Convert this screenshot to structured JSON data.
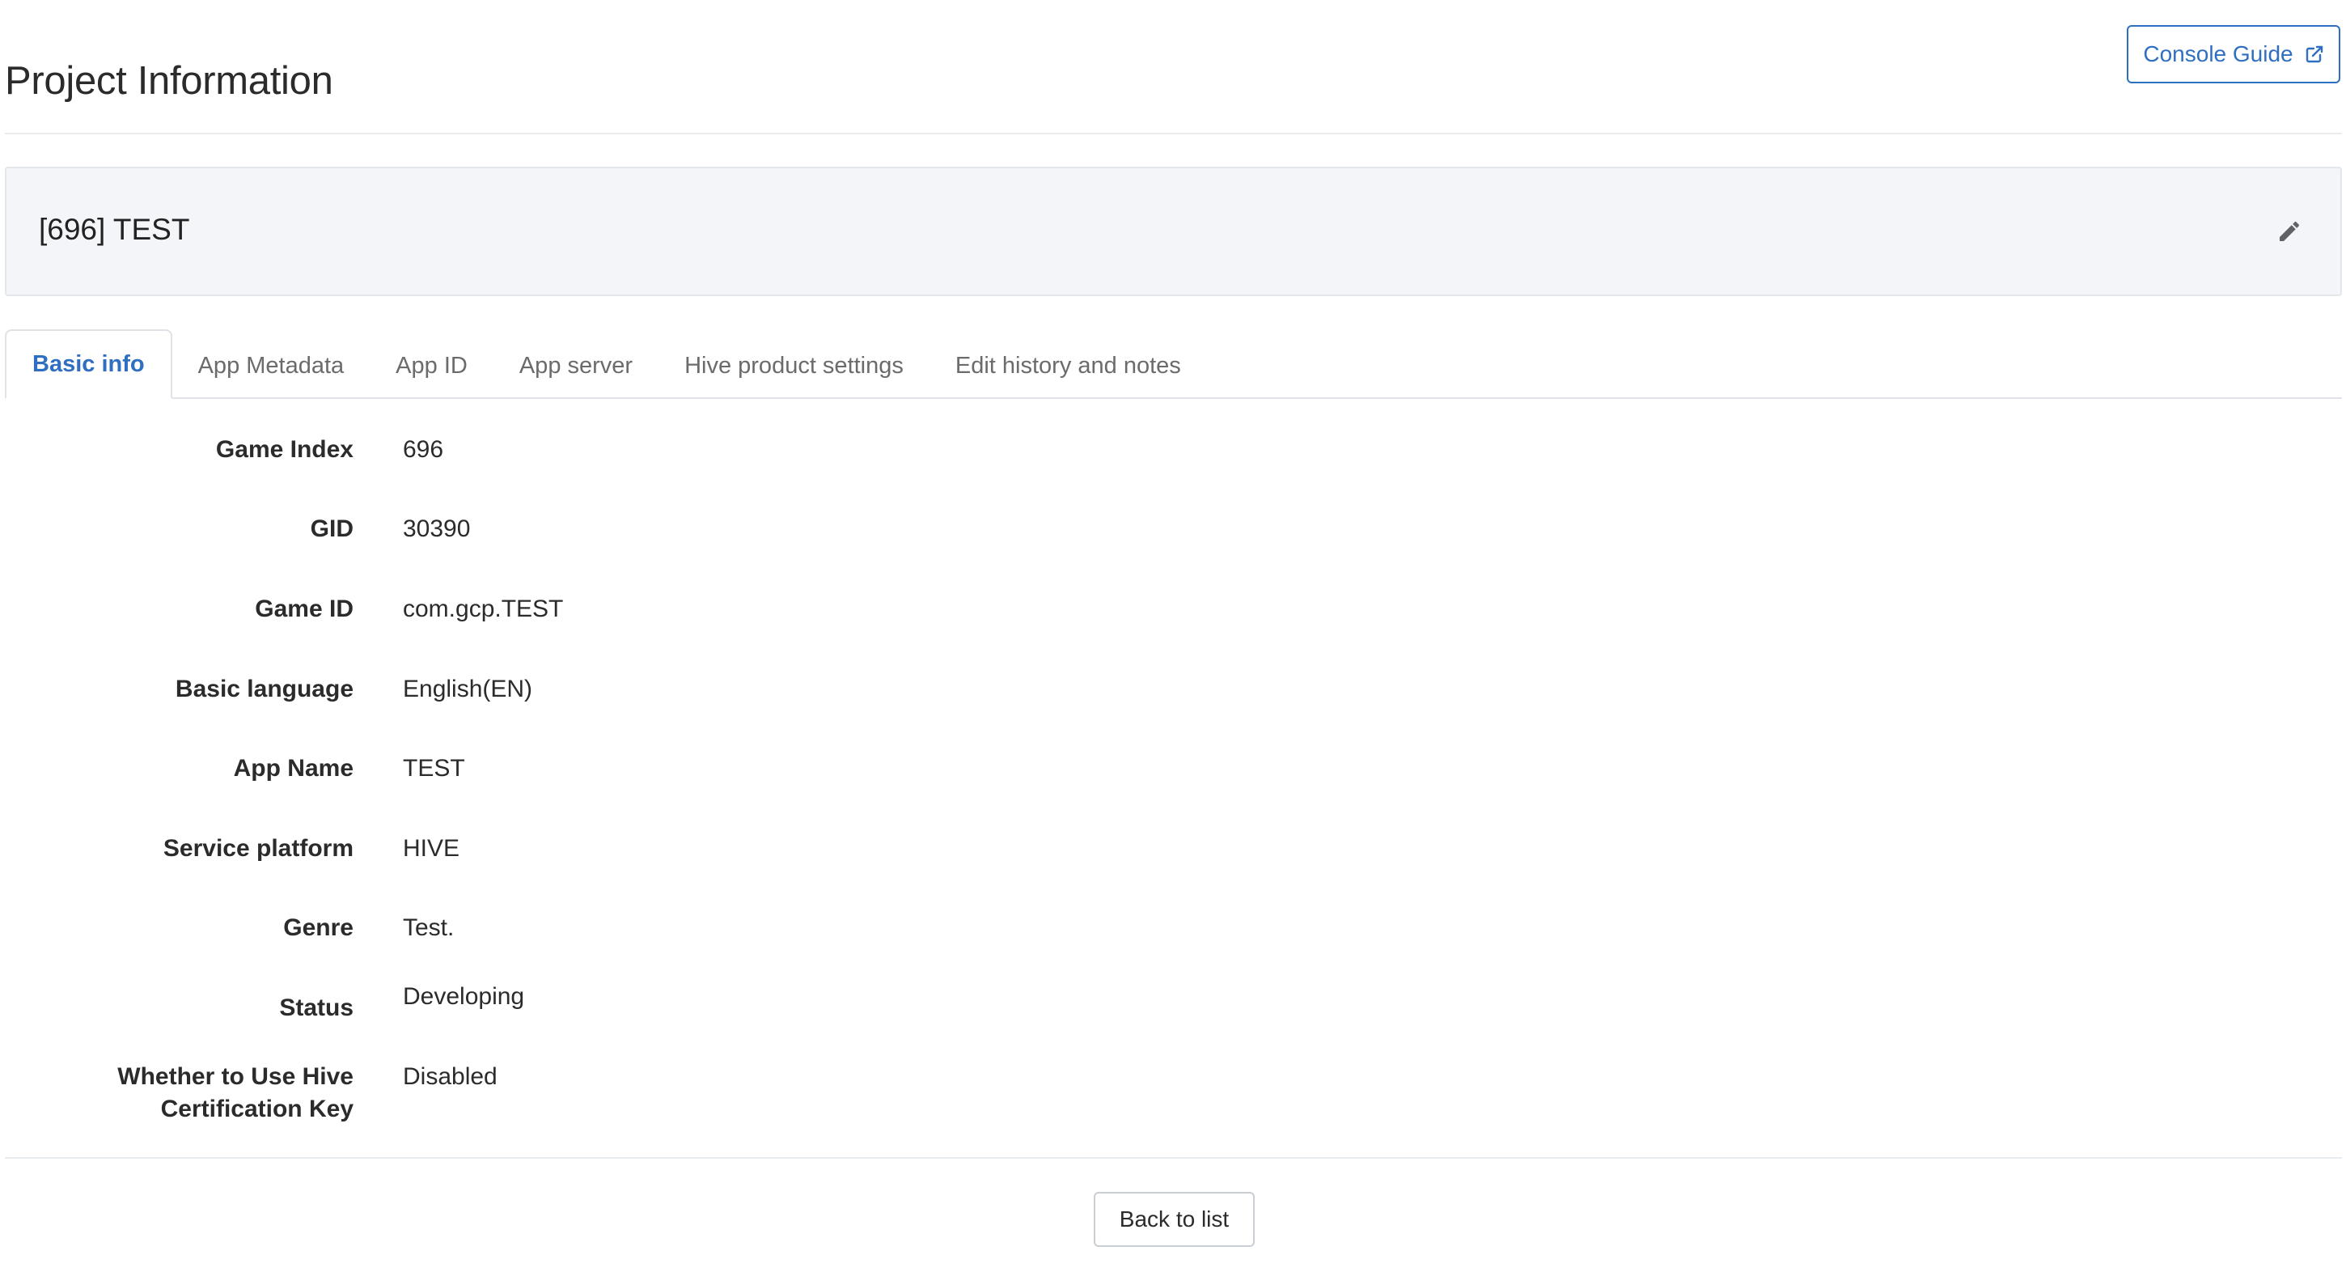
{
  "header": {
    "title": "Project Information",
    "guide_button_label": "Console Guide",
    "guide_icon": "external-link-icon"
  },
  "project": {
    "name": "[696] TEST",
    "edit_icon": "pencil-icon"
  },
  "tabs": [
    {
      "label": "Basic info",
      "active": true
    },
    {
      "label": "App Metadata",
      "active": false
    },
    {
      "label": "App ID",
      "active": false
    },
    {
      "label": "App server",
      "active": false
    },
    {
      "label": "Hive product settings",
      "active": false
    },
    {
      "label": "Edit history and notes",
      "active": false
    }
  ],
  "basic_info": {
    "rows": [
      {
        "label": "Game Index",
        "value": "696"
      },
      {
        "label": "GID",
        "value": "30390"
      },
      {
        "label": "Game ID",
        "value": "com.gcp.TEST"
      },
      {
        "label": "Basic language",
        "value": "English(EN)"
      },
      {
        "label": "App Name",
        "value": "TEST"
      },
      {
        "label": "Service platform",
        "value": "HIVE"
      },
      {
        "label": "Genre",
        "value": "Test."
      },
      {
        "label": "Status",
        "value": "Developing"
      },
      {
        "label": "Whether to Use Hive Certification Key",
        "value": "Disabled"
      }
    ]
  },
  "footer": {
    "back_button_label": "Back to list"
  },
  "colors": {
    "accent": "#2f6fc2",
    "card_background": "#f3f5f8",
    "text": "#2b2b2b",
    "inactive_tab": "#6b6b6b"
  }
}
